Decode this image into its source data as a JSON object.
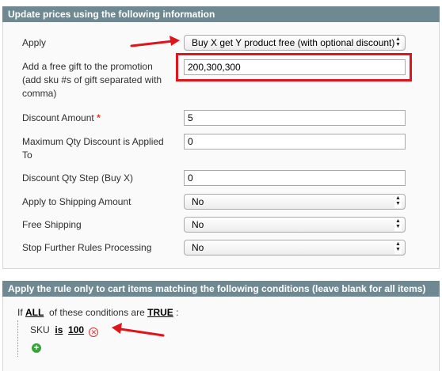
{
  "actions_section": {
    "header": "Update prices using the following information",
    "apply": {
      "label": "Apply",
      "value": "Buy X get Y product free (with optional discount)"
    },
    "free_gift": {
      "label_line1": "Add a free gift to the promotion",
      "label_line2": "(add sku #s of gift separated with",
      "label_line3": "comma)",
      "value": "200,300,300"
    },
    "discount_amount": {
      "label": "Discount Amount",
      "required_mark": "*",
      "value": "5"
    },
    "max_qty_discount": {
      "label_line1": "Maximum Qty Discount is Applied",
      "label_line2": "To",
      "value": "0"
    },
    "discount_qty_step": {
      "label": "Discount Qty Step (Buy X)",
      "value": "0"
    },
    "apply_to_shipping": {
      "label": "Apply to Shipping Amount",
      "value": "No"
    },
    "free_shipping": {
      "label": "Free Shipping",
      "value": "No"
    },
    "stop_further_rules": {
      "label": "Stop Further Rules Processing",
      "value": "No"
    }
  },
  "conditions_section": {
    "header": "Apply the rule only to cart items matching the following conditions (leave blank for all items)",
    "if_text": "If",
    "aggregator": "ALL",
    "middle_text": "of these conditions are",
    "value": "TRUE",
    "colon": ":",
    "condition": {
      "attribute": "SKU",
      "operator": "is",
      "value": "100"
    }
  },
  "icons": {
    "remove": "remove-condition-icon",
    "add": "add-condition-icon",
    "select_arrows": "updown-arrows-icon"
  },
  "colors": {
    "header_bg": "#6f8992",
    "annotation_red": "#e0141b",
    "required_red": "#eb340a"
  }
}
